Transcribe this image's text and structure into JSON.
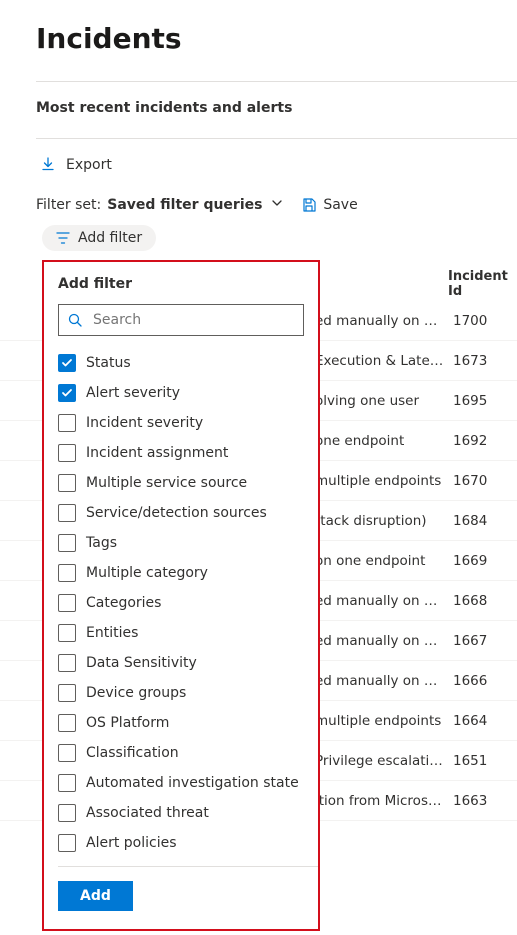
{
  "title": "Incidents",
  "section_label": "Most recent incidents and alerts",
  "export_label": "Export",
  "filter_set": {
    "label": "Filter set:",
    "value": "Saved filter queries",
    "save_label": "Save"
  },
  "add_filter_pill": "Add filter",
  "table": {
    "col_incident_id": "Incident Id",
    "rows": [
      {
        "name": "ed manually on o…",
        "id": "1700"
      },
      {
        "name": "Execution & Late…",
        "id": "1673"
      },
      {
        "name": "olving one user",
        "id": "1695"
      },
      {
        "name": "one endpoint",
        "id": "1692"
      },
      {
        "name": "multiple endpoints",
        "id": "1670"
      },
      {
        "name": "ttack disruption)",
        "id": "1684"
      },
      {
        "name": "on one endpoint",
        "id": "1669"
      },
      {
        "name": "ed manually on o…",
        "id": "1668"
      },
      {
        "name": "ed manually on o…",
        "id": "1667"
      },
      {
        "name": "ed manually on o…",
        "id": "1666"
      },
      {
        "name": "multiple endpoints",
        "id": "1664"
      },
      {
        "name": "Privilege escalati…",
        "id": "1651"
      },
      {
        "name": "ition from Micros…",
        "id": "1663"
      }
    ]
  },
  "popup": {
    "title": "Add filter",
    "search_placeholder": "Search",
    "options": [
      {
        "label": "Status",
        "checked": true
      },
      {
        "label": "Alert severity",
        "checked": true
      },
      {
        "label": "Incident severity",
        "checked": false
      },
      {
        "label": "Incident assignment",
        "checked": false
      },
      {
        "label": "Multiple service source",
        "checked": false
      },
      {
        "label": "Service/detection sources",
        "checked": false
      },
      {
        "label": "Tags",
        "checked": false
      },
      {
        "label": "Multiple category",
        "checked": false
      },
      {
        "label": "Categories",
        "checked": false
      },
      {
        "label": "Entities",
        "checked": false
      },
      {
        "label": "Data Sensitivity",
        "checked": false
      },
      {
        "label": "Device groups",
        "checked": false
      },
      {
        "label": "OS Platform",
        "checked": false
      },
      {
        "label": "Classification",
        "checked": false
      },
      {
        "label": "Automated investigation state",
        "checked": false
      },
      {
        "label": "Associated threat",
        "checked": false
      },
      {
        "label": "Alert policies",
        "checked": false
      }
    ],
    "add_button": "Add"
  }
}
